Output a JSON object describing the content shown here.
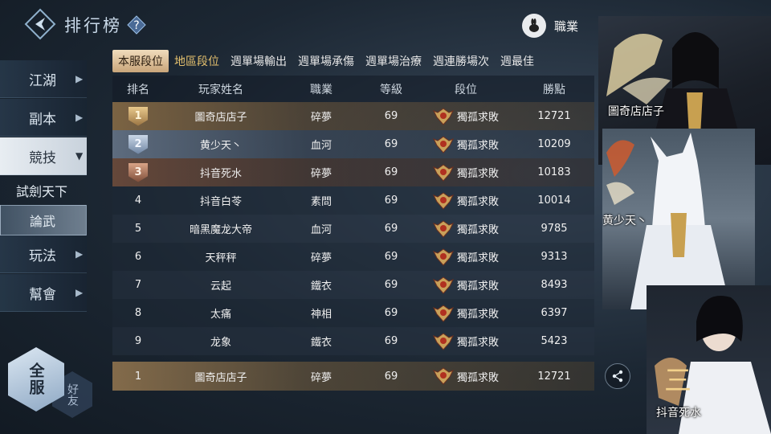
{
  "header": {
    "title": "排行榜",
    "help_icon": "question-icon",
    "job_filter_label": "職業"
  },
  "nav": {
    "items": [
      {
        "label": "江湖",
        "icon": "chevron-right-icon"
      },
      {
        "label": "副本",
        "icon": "chevron-right-icon"
      },
      {
        "label": "競技",
        "icon": "chevron-down-icon",
        "active": true
      }
    ],
    "subitems": [
      {
        "label": "試劍天下"
      },
      {
        "label": "論武",
        "selected": true
      }
    ],
    "items_after": [
      {
        "label": "玩法",
        "icon": "chevron-right-icon"
      },
      {
        "label": "幫會",
        "icon": "chevron-right-icon"
      }
    ]
  },
  "scope": {
    "server_label": "全服",
    "friends_label": "好友"
  },
  "tabs": [
    "本服段位",
    "地區段位",
    "週單場輸出",
    "週單場承傷",
    "週單場治療",
    "週連勝場次",
    "週最佳"
  ],
  "table": {
    "headers": [
      "排名",
      "玩家姓名",
      "職業",
      "等級",
      "段位",
      "勝點"
    ],
    "rows": [
      {
        "rank": "1",
        "name": "圖奇店店子",
        "job": "碎夢",
        "level": "69",
        "segment": "獨孤求敗",
        "points": "12721"
      },
      {
        "rank": "2",
        "name": "黄少天丶",
        "job": "血河",
        "level": "69",
        "segment": "獨孤求敗",
        "points": "10209"
      },
      {
        "rank": "3",
        "name": "抖音死水",
        "job": "碎夢",
        "level": "69",
        "segment": "獨孤求敗",
        "points": "10183"
      },
      {
        "rank": "4",
        "name": "抖音白苓",
        "job": "素問",
        "level": "69",
        "segment": "獨孤求敗",
        "points": "10014"
      },
      {
        "rank": "5",
        "name": "暗黑魔龙大帝",
        "job": "血河",
        "level": "69",
        "segment": "獨孤求敗",
        "points": "9785"
      },
      {
        "rank": "6",
        "name": "天秤秤",
        "job": "碎夢",
        "level": "69",
        "segment": "獨孤求敗",
        "points": "9313"
      },
      {
        "rank": "7",
        "name": "云起",
        "job": "鐵衣",
        "level": "69",
        "segment": "獨孤求敗",
        "points": "8493"
      },
      {
        "rank": "8",
        "name": "太痛",
        "job": "神相",
        "level": "69",
        "segment": "獨孤求敗",
        "points": "6397"
      },
      {
        "rank": "9",
        "name": "龙象",
        "job": "鐵衣",
        "level": "69",
        "segment": "獨孤求敗",
        "points": "5423"
      }
    ],
    "my_row": {
      "rank": "1",
      "name": "圖奇店店子",
      "job": "碎夢",
      "level": "69",
      "segment": "獨孤求敗",
      "points": "12721"
    }
  },
  "podium": [
    {
      "name": "圖奇店店子"
    },
    {
      "name": "黄少天丶"
    },
    {
      "name": "抖音死水"
    }
  ]
}
